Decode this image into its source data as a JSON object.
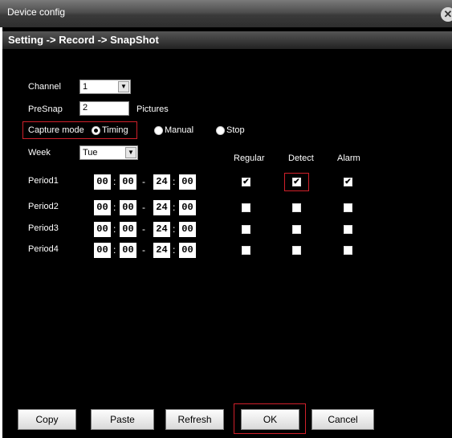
{
  "window": {
    "title": "Device config"
  },
  "breadcrumb": "Setting -> Record -> SnapShot",
  "channel": {
    "label": "Channel",
    "value": "1"
  },
  "presnap": {
    "label": "PreSnap",
    "value": "2",
    "unit": "Pictures"
  },
  "capture_mode": {
    "label": "Capture mode",
    "options": [
      {
        "label": "Timing",
        "selected": true
      },
      {
        "label": "Manual",
        "selected": false
      },
      {
        "label": "Stop",
        "selected": false
      }
    ]
  },
  "week": {
    "label": "Week",
    "value": "Tue"
  },
  "columns": {
    "regular": "Regular",
    "detect": "Detect",
    "alarm": "Alarm"
  },
  "periods": [
    {
      "label": "Period1",
      "start_h": "00",
      "start_m": "00",
      "end_h": "24",
      "end_m": "00",
      "regular": true,
      "detect": true,
      "alarm": true
    },
    {
      "label": "Period2",
      "start_h": "00",
      "start_m": "00",
      "end_h": "24",
      "end_m": "00",
      "regular": false,
      "detect": false,
      "alarm": false
    },
    {
      "label": "Period3",
      "start_h": "00",
      "start_m": "00",
      "end_h": "24",
      "end_m": "00",
      "regular": false,
      "detect": false,
      "alarm": false
    },
    {
      "label": "Period4",
      "start_h": "00",
      "start_m": "00",
      "end_h": "24",
      "end_m": "00",
      "regular": false,
      "detect": false,
      "alarm": false
    }
  ],
  "time_separators": {
    "colon": ":",
    "dash": "-"
  },
  "icons": {
    "close": "close-icon",
    "dropdown": "chevron-down-icon",
    "check": "check-icon"
  },
  "glyphs": {
    "close": "✕",
    "arrow": "▼",
    "check": "✔"
  },
  "buttons": {
    "copy": "Copy",
    "paste": "Paste",
    "refresh": "Refresh",
    "ok": "OK",
    "cancel": "Cancel"
  },
  "colors": {
    "highlight": "#d0202a",
    "background": "#000000",
    "text": "#ffffff"
  }
}
